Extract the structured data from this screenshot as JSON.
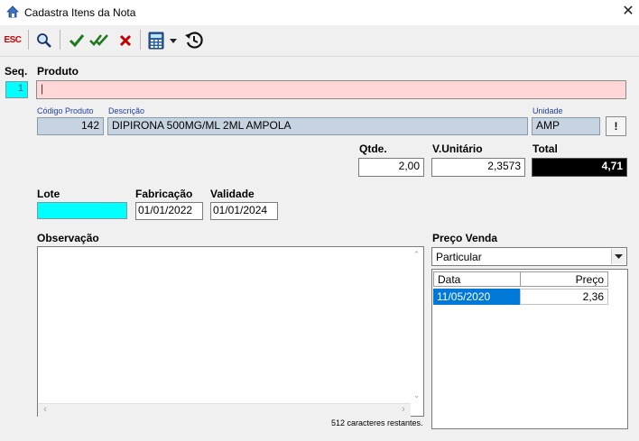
{
  "window": {
    "title": "Cadastra Itens da Nota"
  },
  "toolbar": {
    "esc_label": "ESC"
  },
  "seq": {
    "label": "Seq.",
    "value": "1"
  },
  "produto": {
    "label": "Produto",
    "value": "|"
  },
  "codigo": {
    "label": "Código Produto",
    "value": "142"
  },
  "descricao": {
    "label": "Descrição",
    "value": "DIPIRONA 500MG/ML 2ML AMPOLA"
  },
  "unidade": {
    "label": "Unidade",
    "value": "AMP"
  },
  "info_button": {
    "label": "!"
  },
  "qtde": {
    "label": "Qtde.",
    "value": "2,00"
  },
  "valor_unitario": {
    "label": "V.Unitário",
    "value": "2,3573"
  },
  "total": {
    "label": "Total",
    "value": "4,71"
  },
  "lote": {
    "label": "Lote",
    "value": ""
  },
  "fabricacao": {
    "label": "Fabricação",
    "value": "01/01/2022"
  },
  "validade": {
    "label": "Validade",
    "value": "01/01/2024"
  },
  "observacao": {
    "label": "Observação",
    "value": "",
    "remaining": "512 caracteres restantes."
  },
  "preco_venda": {
    "label": "Preço Venda",
    "selected": "Particular",
    "columns": [
      "Data",
      "Preço"
    ],
    "rows": [
      {
        "data": "11/05/2020",
        "preco": "2,36"
      }
    ]
  },
  "colors": {
    "accent_selected": "#0078d7",
    "seq_bg": "#00ffff",
    "produto_bg": "#ffd7d7",
    "readonly_bg": "#c6d4e1"
  }
}
